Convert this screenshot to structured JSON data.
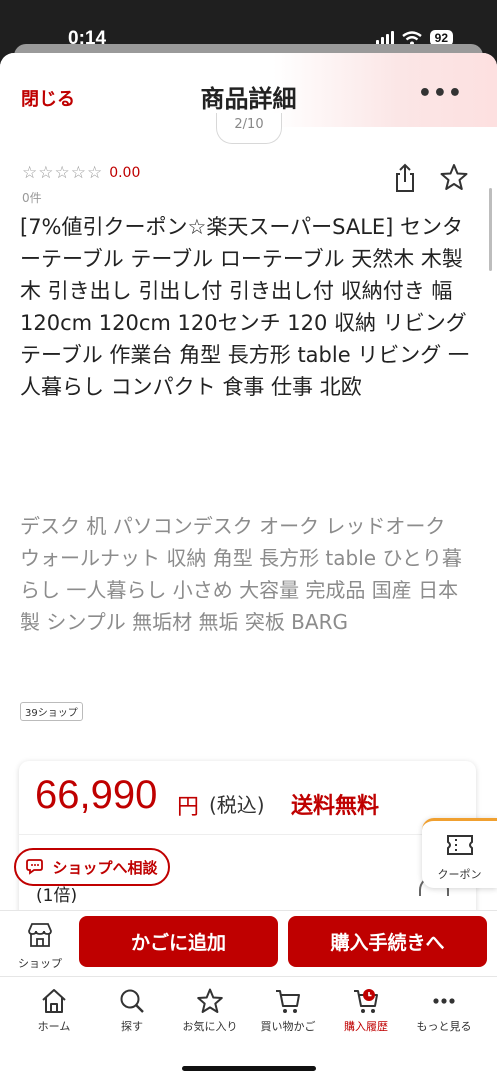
{
  "status_bar": {
    "time": "0:14",
    "battery": "92"
  },
  "header": {
    "close_label": "閉じる",
    "title": "商品詳細",
    "more_label": "•••"
  },
  "image_counter": "2/10",
  "rating": {
    "stars": "☆☆☆☆☆",
    "value": "0.00",
    "review_count": "0件"
  },
  "product": {
    "title": "[7%値引クーポン☆楽天スーパーSALE] センターテーブル テーブル ローテーブル 天然木 木製 木 引き出し 引出し付 引き出し付 収納付き 幅120cm 120cm 120センチ 120 収納 リビングテーブル 作業台 角型 長方形 table リビング 一人暮らし コンパクト 食事 仕事 北欧",
    "description": "デスク 机 パソコンデスク オーク レッドオーク ウォールナット 収納 角型 長方形 table ひとり暮らし 一人暮らし 小さめ 大容量 完成品 国産 日本製 シンプル 無垢材 無垢 突板 BARG",
    "shop_badge": "39ショップ"
  },
  "price": {
    "amount": "66,990",
    "currency": "円",
    "tax_label": "(税込)",
    "shipping": "送料無料",
    "multiplier": "(1倍)"
  },
  "consult_button": "ショップへ相談",
  "coupon_label": "クーポン",
  "action_bar": {
    "shop_label": "ショップ",
    "add_to_cart": "かごに追加",
    "checkout": "購入手続きへ"
  },
  "tabbar": {
    "items": [
      {
        "label": "ホーム",
        "icon": "home-icon"
      },
      {
        "label": "探す",
        "icon": "search-icon"
      },
      {
        "label": "お気に入り",
        "icon": "star-icon"
      },
      {
        "label": "買い物かご",
        "icon": "cart-icon"
      },
      {
        "label": "購入履歴",
        "icon": "history-icon"
      },
      {
        "label": "もっと見る",
        "icon": "more-icon"
      }
    ],
    "active_index": 4
  },
  "colors": {
    "accent": "#bf0000",
    "coupon_accent": "#f0a030"
  }
}
